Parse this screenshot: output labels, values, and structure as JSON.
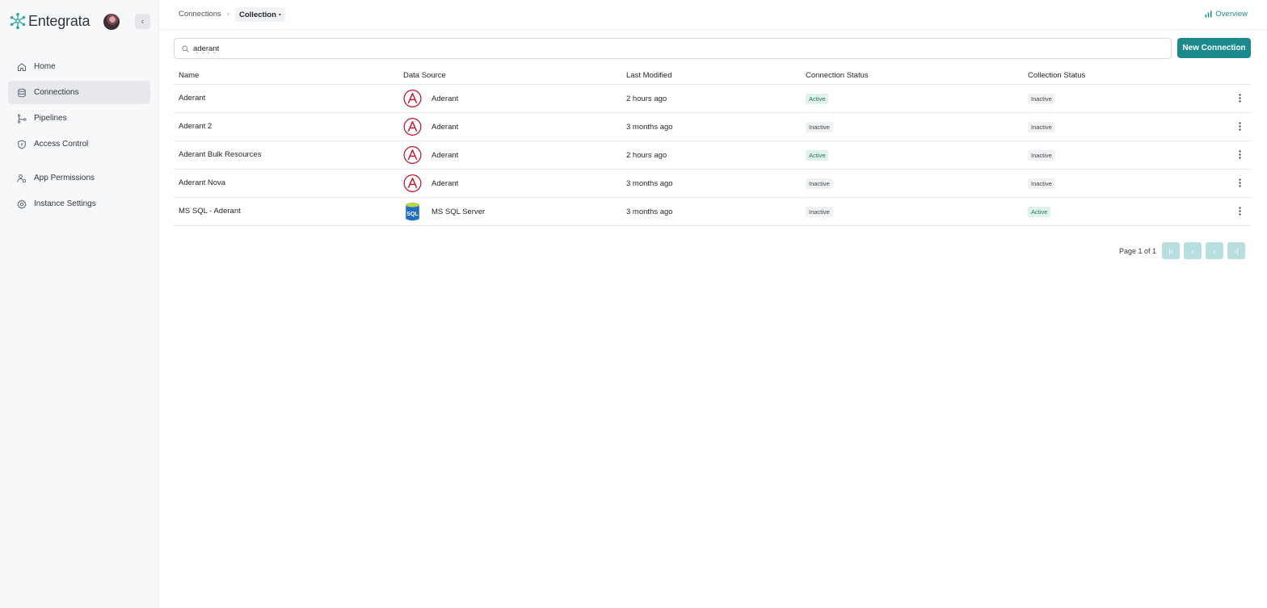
{
  "app": {
    "name": "Entegrata"
  },
  "sidebar": {
    "collapse_icon": "‹",
    "items": [
      {
        "label": "Home",
        "icon": "home-icon"
      },
      {
        "label": "Connections",
        "icon": "database-icon",
        "active": true
      },
      {
        "label": "Pipelines",
        "icon": "pipeline-icon"
      },
      {
        "label": "Access Control",
        "icon": "shield-icon"
      },
      {
        "label": "App Permissions",
        "icon": "user-permissions-icon"
      },
      {
        "label": "Instance Settings",
        "icon": "gear-icon"
      }
    ]
  },
  "breadcrumb": {
    "parent": "Connections",
    "separator": "›",
    "current": "Collection",
    "caret": "▾"
  },
  "header": {
    "overview_label": "Overview"
  },
  "search": {
    "value": "aderant",
    "placeholder": ""
  },
  "toolbar": {
    "new_connection_label": "New Connection"
  },
  "table": {
    "columns": [
      "Name",
      "Data Source",
      "Last Modified",
      "Connection Status",
      "Collection Status"
    ],
    "rows": [
      {
        "name": "Aderant",
        "source": "Aderant",
        "source_icon": "aderant-logo",
        "modified": "2 hours ago",
        "connection_status": "Active",
        "collection_status": "Inactive"
      },
      {
        "name": "Aderant 2",
        "source": "Aderant",
        "source_icon": "aderant-logo",
        "modified": "3 months ago",
        "connection_status": "Inactive",
        "collection_status": "Inactive"
      },
      {
        "name": "Aderant Bulk Resources",
        "source": "Aderant",
        "source_icon": "aderant-logo",
        "modified": "2 hours ago",
        "connection_status": "Active",
        "collection_status": "Inactive"
      },
      {
        "name": "Aderant Nova",
        "source": "Aderant",
        "source_icon": "aderant-logo",
        "modified": "3 months ago",
        "connection_status": "Inactive",
        "collection_status": "Inactive"
      },
      {
        "name": "MS SQL - Aderant",
        "source": "MS SQL Server",
        "source_icon": "sql-server-logo",
        "source_icon_text": "SQL",
        "modified": "3 months ago",
        "connection_status": "Inactive",
        "collection_status": "Active"
      }
    ]
  },
  "pagination": {
    "label": "Page 1 of 1",
    "buttons": [
      "|‹",
      "‹",
      "›",
      "›|"
    ]
  },
  "colors": {
    "accent": "#1b8a8c",
    "active_badge_bg": "#dff3ea",
    "inactive_badge_bg": "#f0f1f3",
    "aderant_red": "#c8102e"
  }
}
